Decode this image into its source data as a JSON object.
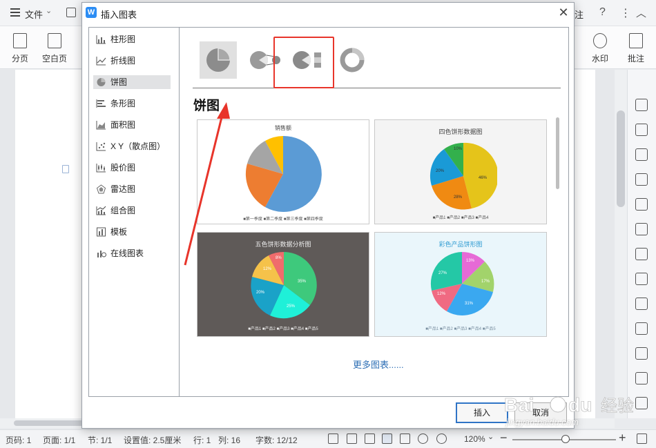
{
  "app": {
    "menu_file": "文件",
    "ribbon": {
      "page_break": "分页",
      "blank_page": "空白页",
      "watermark": "水印",
      "comment": "批注",
      "partial_right_label": "注"
    }
  },
  "statusbar": {
    "page_num": "页码: 1",
    "page": "页面: 1/1",
    "section": "节: 1/1",
    "setting": "设置值: 2.5厘米",
    "row": "行: 1",
    "col": "列: 16",
    "chars": "字数: 12/12",
    "zoom": "120%"
  },
  "dialog": {
    "title": "插入图表",
    "logo": "W",
    "close": "✕",
    "sidebar": [
      {
        "label": "柱形图",
        "icon": "bar-chart-icon"
      },
      {
        "label": "折线图",
        "icon": "line-chart-icon"
      },
      {
        "label": "饼图",
        "icon": "pie-chart-icon",
        "active": true
      },
      {
        "label": "条形图",
        "icon": "horizontal-bar-icon"
      },
      {
        "label": "面积图",
        "icon": "area-chart-icon"
      },
      {
        "label": "X Y（散点图）",
        "icon": "scatter-chart-icon"
      },
      {
        "label": "股价图",
        "icon": "stock-chart-icon"
      },
      {
        "label": "雷达图",
        "icon": "radar-chart-icon"
      },
      {
        "label": "组合图",
        "icon": "combo-chart-icon"
      },
      {
        "label": "模板",
        "icon": "template-icon"
      },
      {
        "label": "在线图表",
        "icon": "online-chart-icon"
      }
    ],
    "heading": "饼图",
    "templates": [
      {
        "title": "销售额",
        "legend": "■第一季度 ■第二季度 ■第三季度 ■第四季度"
      },
      {
        "title": "四色饼形数据图",
        "legend": "■产品1 ■产品2 ■产品3 ■产品4",
        "labels": [
          "46%",
          "28%",
          "20%",
          "10%"
        ]
      },
      {
        "title": "五色饼形数据分析图",
        "legend": "■产品1 ■产品2 ■产品3 ■产品4 ■产品5",
        "labels": [
          "35%",
          "25%",
          "20%",
          "12%",
          "8%"
        ]
      },
      {
        "title": "彩色产品饼形图",
        "legend": "■产品1 ■产品2 ■产品3 ■产品4 ■产品5",
        "labels": [
          "13%",
          "17%",
          "31%",
          "12%",
          "27%"
        ]
      }
    ],
    "more_link": "更多图表......",
    "insert_button": "插入",
    "cancel_button": "取消"
  },
  "colors": {
    "accent_blue": "#2f74c6",
    "highlight_red": "#e8342a",
    "link_blue": "#2e6fb5"
  }
}
